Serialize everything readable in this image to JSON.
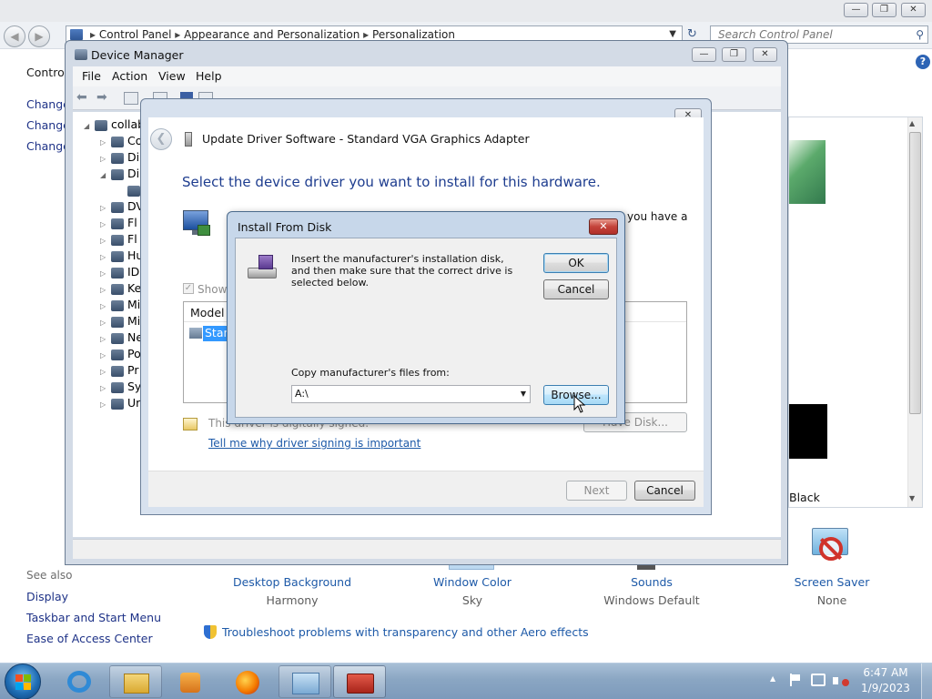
{
  "control_panel": {
    "breadcrumb": [
      "Control Panel",
      "Appearance and Personalization",
      "Personalization"
    ],
    "search_placeholder": "Search Control Panel",
    "left_heading": "Control",
    "left_links": [
      "Change",
      "Change",
      "Change"
    ],
    "see_also_label": "See also",
    "see_also_links": [
      "Display",
      "Taskbar and Start Menu",
      "Ease of Access Center"
    ],
    "bottom_items": [
      {
        "title": "Desktop Background",
        "value": "Harmony"
      },
      {
        "title": "Window Color",
        "value": "Sky"
      },
      {
        "title": "Sounds",
        "value": "Windows Default"
      },
      {
        "title": "Screen Saver",
        "value": "None"
      }
    ],
    "troubleshoot_link": "Troubleshoot problems with transparency and other Aero effects",
    "theme_partial_text": "Black"
  },
  "device_manager": {
    "title": "Device Manager",
    "menu": [
      "File",
      "Action",
      "View",
      "Help"
    ],
    "tree": [
      {
        "label": "collab",
        "indent": 0
      },
      {
        "label": "Co",
        "indent": 1
      },
      {
        "label": "Di",
        "indent": 1
      },
      {
        "label": "Di",
        "indent": 1
      },
      {
        "label": "",
        "indent": 2
      },
      {
        "label": "DV",
        "indent": 1
      },
      {
        "label": "Fl",
        "indent": 1
      },
      {
        "label": "Fl",
        "indent": 1
      },
      {
        "label": "Hu",
        "indent": 1
      },
      {
        "label": "ID",
        "indent": 1
      },
      {
        "label": "Ke",
        "indent": 1
      },
      {
        "label": "Mi",
        "indent": 1
      },
      {
        "label": "Mi",
        "indent": 1
      },
      {
        "label": "Ne",
        "indent": 1
      },
      {
        "label": "Po",
        "indent": 1
      },
      {
        "label": "Pr",
        "indent": 1
      },
      {
        "label": "Sy",
        "indent": 1
      },
      {
        "label": "Ur",
        "indent": 1
      }
    ]
  },
  "update_driver": {
    "title": "Update Driver Software - Standard VGA Graphics Adapter",
    "heading": "Select the device driver you want to install for this hardware.",
    "partial_text": "you have a",
    "show_compatible": "Show",
    "model_header": "Model",
    "model_item": "Stand",
    "signed_text": "This driver is digitally signed.",
    "signing_link": "Tell me why driver signing is important",
    "have_disk_label": "Have Disk...",
    "next_label": "Next",
    "cancel_label": "Cancel"
  },
  "install_from_disk": {
    "title": "Install From Disk",
    "instruction": "Insert the manufacturer's installation disk, and then make sure that the correct drive is selected below.",
    "ok_label": "OK",
    "cancel_label": "Cancel",
    "copy_label": "Copy manufacturer's files from:",
    "path_value": "A:\\",
    "browse_label": "Browse..."
  },
  "taskbar": {
    "time": "6:47 AM",
    "date": "1/9/2023"
  },
  "colors": {
    "link_blue": "#1e5aa8",
    "heading_blue": "#1e3d8f",
    "close_red": "#c4433a"
  }
}
